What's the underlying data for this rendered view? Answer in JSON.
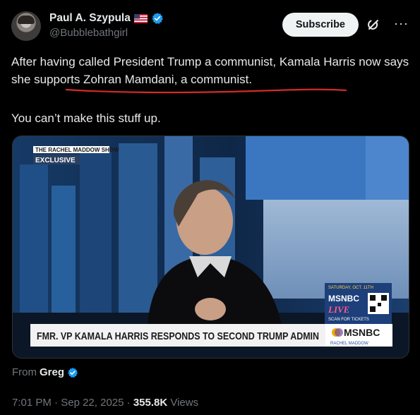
{
  "author": {
    "display_name": "Paul A. Szypula",
    "handle": "@Bubblebathgirl"
  },
  "actions": {
    "subscribe_label": "Subscribe",
    "more_label": "···"
  },
  "post": {
    "text_before": "After having called President Trump a communist, Kamala Harris now says ",
    "text_underlined": "she supports Zohran Mamdani, a communist",
    "text_after": ".",
    "text_p2": "You can’t make this stuff up."
  },
  "video": {
    "show_logo": "THE RACHEL MADDOW SHOW",
    "exclusive_tag": "EXCLUSIVE",
    "chyron": "FMR. VP KAMALA HARRIS RESPONDS TO SECOND TRUMP ADMIN",
    "network": "MSNBC",
    "network_sub": "RACHEL MADDOW",
    "promo_date": "SATURDAY, OCT. 11TH",
    "promo_brand": "MSNBC",
    "promo_live": "LIVE",
    "promo_scan": "SCAN FOR TICKETS"
  },
  "source": {
    "prefix": "From",
    "name": "Greg"
  },
  "meta": {
    "time": "7:01 PM",
    "separator": "·",
    "date": "Sep 22, 2025",
    "views_count": "355.8K",
    "views_label": "Views"
  },
  "colors": {
    "accent_blue": "#1d9bf0",
    "underline_red": "#d42a2a",
    "muted": "#71767b"
  }
}
